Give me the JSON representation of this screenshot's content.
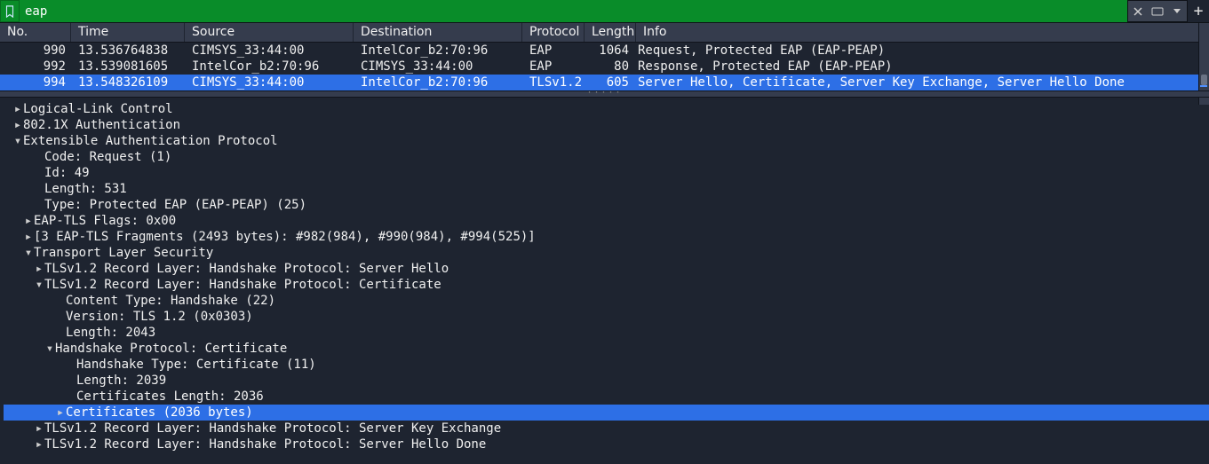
{
  "filter": {
    "value": "eap"
  },
  "columns": {
    "no": "No.",
    "time": "Time",
    "source": "Source",
    "destination": "Destination",
    "protocol": "Protocol",
    "length": "Length",
    "info": "Info"
  },
  "packets": [
    {
      "no": "990",
      "time": "13.536764838",
      "source": "CIMSYS_33:44:00",
      "destination": "IntelCor_b2:70:96",
      "protocol": "EAP",
      "length": "1064",
      "info": "Request, Protected EAP (EAP-PEAP)",
      "selected": false
    },
    {
      "no": "992",
      "time": "13.539081605",
      "source": "IntelCor_b2:70:96",
      "destination": "CIMSYS_33:44:00",
      "protocol": "EAP",
      "length": "80",
      "info": "Response, Protected EAP (EAP-PEAP)",
      "selected": false
    },
    {
      "no": "994",
      "time": "13.548326109",
      "source": "CIMSYS_33:44:00",
      "destination": "IntelCor_b2:70:96",
      "protocol": "TLSv1.2",
      "length": "605",
      "info": "Server Hello, Certificate, Server Key Exchange, Server Hello Done",
      "selected": true
    }
  ],
  "details": {
    "llc": "Logical-Link Control",
    "dot1x": "802.1X Authentication",
    "eap": {
      "label": "Extensible Authentication Protocol",
      "code": "Code: Request (1)",
      "id": "Id: 49",
      "length": "Length: 531",
      "type": "Type: Protected EAP (EAP-PEAP) (25)",
      "flags": "EAP-TLS Flags: 0x00",
      "frags": "[3 EAP-TLS Fragments (2493 bytes): #982(984), #990(984), #994(525)]",
      "tls": {
        "label": "Transport Layer Security",
        "rec_hello": "TLSv1.2 Record Layer: Handshake Protocol: Server Hello",
        "rec_cert": {
          "label": "TLSv1.2 Record Layer: Handshake Protocol: Certificate",
          "ctype": "Content Type: Handshake (22)",
          "ver": "Version: TLS 1.2 (0x0303)",
          "len": "Length: 2043",
          "hs": {
            "label": "Handshake Protocol: Certificate",
            "htype": "Handshake Type: Certificate (11)",
            "hlen": "Length: 2039",
            "clen": "Certificates Length: 2036",
            "certs": "Certificates (2036 bytes)"
          }
        },
        "rec_kex": "TLSv1.2 Record Layer: Handshake Protocol: Server Key Exchange",
        "rec_done": "TLSv1.2 Record Layer: Handshake Protocol: Server Hello Done"
      }
    }
  }
}
